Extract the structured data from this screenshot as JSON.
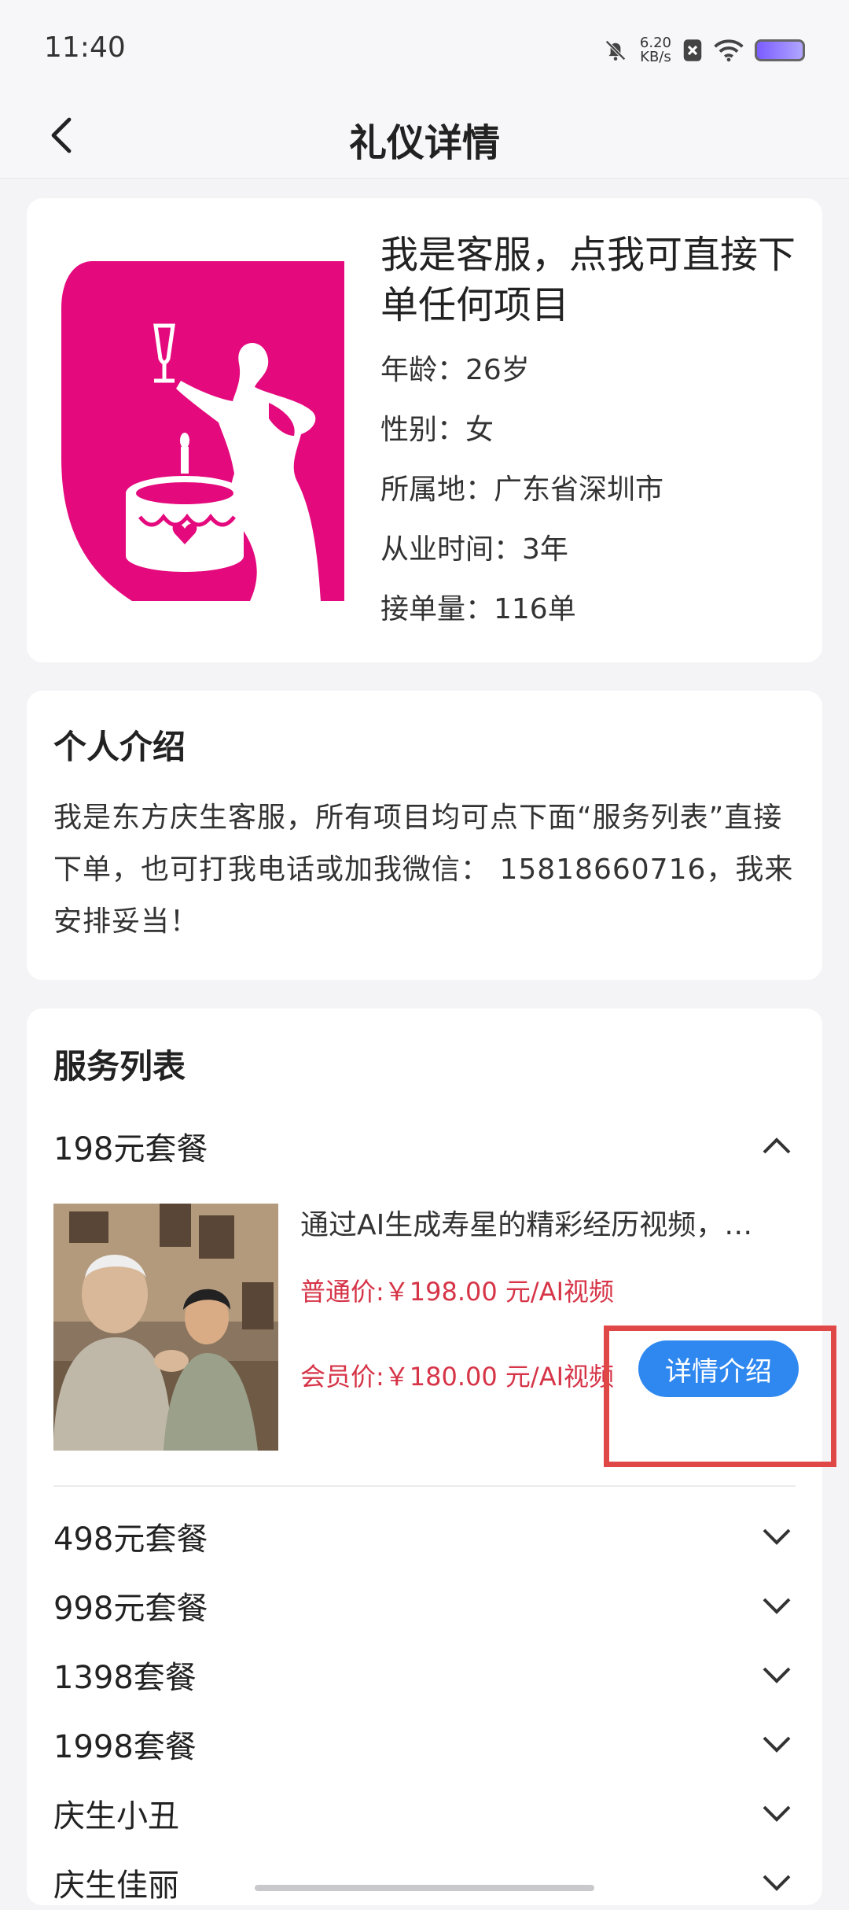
{
  "status_bar": {
    "time": "11:40",
    "net_speed_value": "6.20",
    "net_speed_unit": "KB/s"
  },
  "header": {
    "title": "礼仪详情"
  },
  "profile": {
    "name": "我是客服，点我可直接下单任何项目",
    "age": "年龄：26岁",
    "gender": "性别：女",
    "location": "所属地：广东省深圳市",
    "experience": "从业时间：3年",
    "orders": "接单量：116单",
    "brand_color": "#e4097d"
  },
  "intro": {
    "title": "个人介绍",
    "text": "我是东方庆生客服，所有项目均可点下面“服务列表”直接下单，也可打我电话或加我微信： 15818660716，我来安排妥当！"
  },
  "services": {
    "title": "服务列表",
    "expanded": {
      "label": "198元套餐",
      "description": "通过AI生成寿星的精彩经历视频，…",
      "normal_price": "普通价:￥198.00 元/AI视频",
      "member_price": "会员价:￥180.00 元/AI视频",
      "detail_button": "详情介绍"
    },
    "packages": [
      {
        "label": "498元套餐"
      },
      {
        "label": "998元套餐"
      },
      {
        "label": "1398套餐"
      },
      {
        "label": "1998套餐"
      },
      {
        "label": "庆生小丑"
      },
      {
        "label": "庆生佳丽"
      }
    ]
  },
  "colors": {
    "accent": "#2f88f0",
    "price": "#d63447",
    "highlight": "#e04848"
  }
}
